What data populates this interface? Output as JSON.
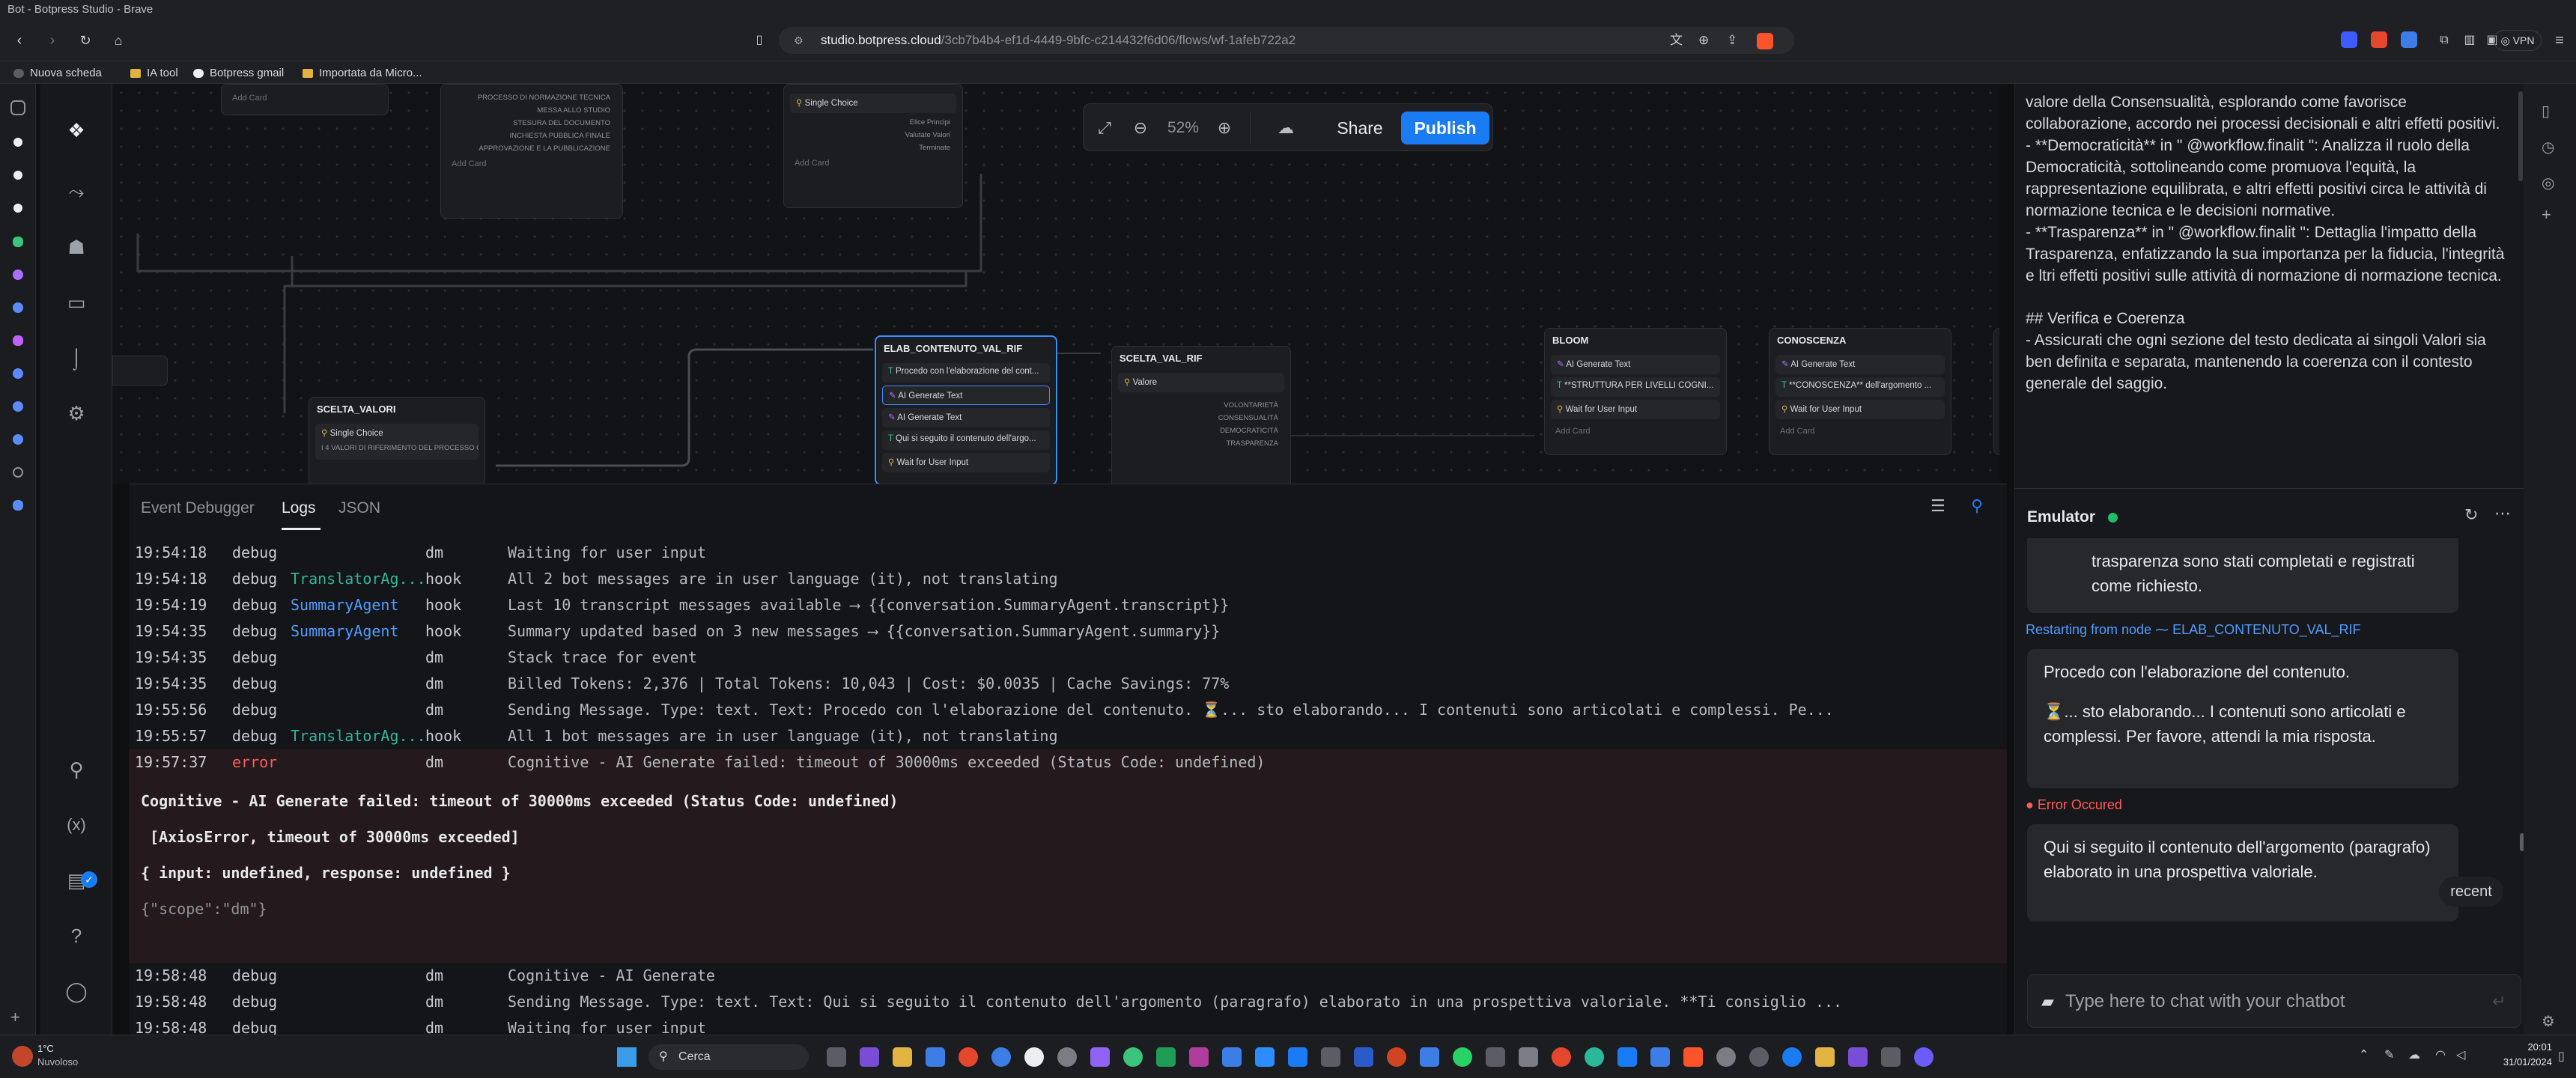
{
  "window": {
    "title": "Bot - Botpress Studio - Brave"
  },
  "browser": {
    "url_host": "studio.botpress.cloud",
    "url_path": "/3cb7b4b4-ef1d-4449-9bfc-c214432f6d06/flows/wf-1afeb722a2",
    "vpn_label": "VPN",
    "bookmarks": [
      "Nuova scheda",
      "IA tool",
      "Botpress gmail",
      "Importata da Micro..."
    ]
  },
  "toolbar": {
    "zoom": "52%",
    "share_label": "Share",
    "publish_label": "Publish"
  },
  "canvas": {
    "nodes": {
      "top_left": {
        "add": "Add Card"
      },
      "processi": {
        "outputs": [
          "PROCESSO DI NORMAZIONE TECNICA",
          "MESSA ALLO STUDIO",
          "STESURA DEL DOCUMENTO",
          "INCHIESTA PUBBLICA FINALE",
          "APPROVAZIONE E LA PUBBLICAZIONE"
        ],
        "add": "Add Card"
      },
      "single_choice_top": {
        "card": "Single Choice",
        "outputs": [
          "Elice Principi",
          "Valutate Valori",
          "Terminate"
        ],
        "add": "Add Card"
      },
      "scelta_valori": {
        "title": "SCELTA_VALORI",
        "card": "Single Choice",
        "sub": "I 4 VALORI DI RIFERIMENTO DEL PROCESSO O..."
      },
      "elab": {
        "title": "ELAB_CONTENUTO_VAL_RIF",
        "cards": [
          "Procedo con l'elaborazione del cont...",
          "AI Generate Text",
          "AI Generate Text",
          "Qui si seguito il contenuto dell'argo...",
          "Wait for User Input"
        ]
      },
      "scelta_val_rif": {
        "title": "SCELTA_VAL_RIF",
        "card": "Valore",
        "outputs": [
          "VOLONTARIETÀ",
          "CONSENSUALITÀ",
          "DEMOCRATICITÀ",
          "TRASPARENZA"
        ]
      },
      "bloom": {
        "title": "BLOOM",
        "cards": [
          "AI Generate Text",
          "**STRUTTURA PER LIVELLI COGNI...",
          "Wait for User Input"
        ],
        "add": "Add Card"
      },
      "conoscenza": {
        "title": "CONOSCENZA",
        "cards": [
          "AI Generate Text",
          "**CONOSCENZA** dell'argomento ...",
          "Wait for User Input"
        ],
        "add": "Add Card"
      }
    }
  },
  "logs": {
    "tabs": [
      "Event Debugger",
      "Logs",
      "JSON"
    ],
    "rows_before": [
      {
        "time": "19:54:18",
        "level": "debug",
        "agent": "",
        "source": "dm",
        "message": "Waiting for user input"
      },
      {
        "time": "19:54:18",
        "level": "debug",
        "agent": "TranslatorAg...",
        "source": "hook",
        "message": "All 2 bot messages are in user language (it), not translating"
      },
      {
        "time": "19:54:19",
        "level": "debug",
        "agent": "SummaryAgent",
        "source": "hook",
        "message": "Last 10 transcript messages available ⟶ {{conversation.SummaryAgent.transcript}}"
      },
      {
        "time": "19:54:35",
        "level": "debug",
        "agent": "SummaryAgent",
        "source": "hook",
        "message": "Summary updated based on 3 new messages ⟶ {{conversation.SummaryAgent.summary}}"
      },
      {
        "time": "19:54:35",
        "level": "debug",
        "agent": "",
        "source": "dm",
        "message": "Stack trace for event"
      },
      {
        "time": "19:54:35",
        "level": "debug",
        "agent": "",
        "source": "dm",
        "message": "Billed Tokens: 2,376 | Total Tokens: 10,043 | Cost: $0.0035 | Cache Savings: 77%"
      },
      {
        "time": "19:55:56",
        "level": "debug",
        "agent": "",
        "source": "dm",
        "message": "Sending Message. Type: text. Text: Procedo con l'elaborazione del contenuto. ⏳... sto elaborando... I contenuti sono articolati e complessi. Pe..."
      },
      {
        "time": "19:55:57",
        "level": "debug",
        "agent": "TranslatorAg...",
        "source": "hook",
        "message": "All 1 bot messages are in user language (it), not translating"
      }
    ],
    "error_row": {
      "time": "19:57:37",
      "level": "error",
      "source": "dm",
      "message": "Cognitive - AI Generate failed: timeout of 30000ms exceeded (Status Code: undefined)"
    },
    "error_detail": [
      "Cognitive - AI Generate failed: timeout of 30000ms exceeded (Status Code: undefined)",
      " [AxiosError, timeout of 30000ms exceeded]",
      "{ input: undefined, response: undefined }"
    ],
    "error_scope": "{\"scope\":\"dm\"}",
    "rows_after": [
      {
        "time": "19:58:48",
        "level": "debug",
        "agent": "",
        "source": "dm",
        "message": "Cognitive - AI Generate"
      },
      {
        "time": "19:58:48",
        "level": "debug",
        "agent": "",
        "source": "dm",
        "message": "Sending Message. Type: text. Text: Qui si seguito il contenuto dell'argomento (paragrafo) elaborato in una prospettiva valoriale. **Ti consiglio ..."
      },
      {
        "time": "19:58:48",
        "level": "debug",
        "agent": "",
        "source": "dm",
        "message": "Waiting for user input"
      },
      {
        "time": "19:58:49",
        "level": "debug",
        "agent": "TranslatorAg...",
        "source": "hook",
        "message": "All 1 bot messages are in user language (it), not translating"
      }
    ]
  },
  "markdown_panel": {
    "lines": [
      "valore della Consensualità, esplorando come favorisce collaborazione, accordo nei processi decisionali e altri effetti positivi.",
      "- **Democraticità**  in \" @workflow.finalit \": Analizza il ruolo della Democraticità, sottolineando come promuova l'equità, la rappresentazione equilibrata, e altri effetti positivi circa le attività di normazione tecnica e le decisioni normative.",
      "- **Trasparenza**  in \" @workflow.finalit \": Dettaglia l'impatto della Trasparenza, enfatizzando la sua importanza per la fiducia, l'integrità e ltri effetti positivi sulle attività di normazione di normazione tecnica.",
      "## Verifica e Coerenza",
      "- Assicurati che ogni sezione del testo dedicata ai singoli Valori sia ben definita e separata, mantenendo la coerenza con il contesto generale del saggio."
    ]
  },
  "emulator": {
    "title": "Emulator",
    "msg_prev": "trasparenza sono stati completati e registrati come richiesto.",
    "restart_note": "Restarting from node ⁓ ELAB_CONTENUTO_VAL_RIF",
    "msg_1_a": "Procedo con l'elaborazione del contenuto.",
    "msg_1_b": "⏳... sto elaborando... I contenuti sono articolati e complessi. Per favore, attendi la mia risposta.",
    "error_note": "Error Occured",
    "msg_2": "Qui si seguito il contenuto dell'argomento (paragrafo) elaborato in una prospettiva valoriale.",
    "recent_label": "recent",
    "input_placeholder": "Type here to chat with your chatbot"
  },
  "taskbar": {
    "weather_temp": "1°C",
    "weather_desc": "Nuvoloso",
    "search_label": "Cerca",
    "time": "20:01",
    "date": "31/01/2024"
  },
  "colors": {
    "accent": "#1a7cf5",
    "error": "#ff5b5b",
    "online": "#1fbf6a",
    "agent_summary": "#4f9dff",
    "agent_translator": "#2bb79a"
  }
}
